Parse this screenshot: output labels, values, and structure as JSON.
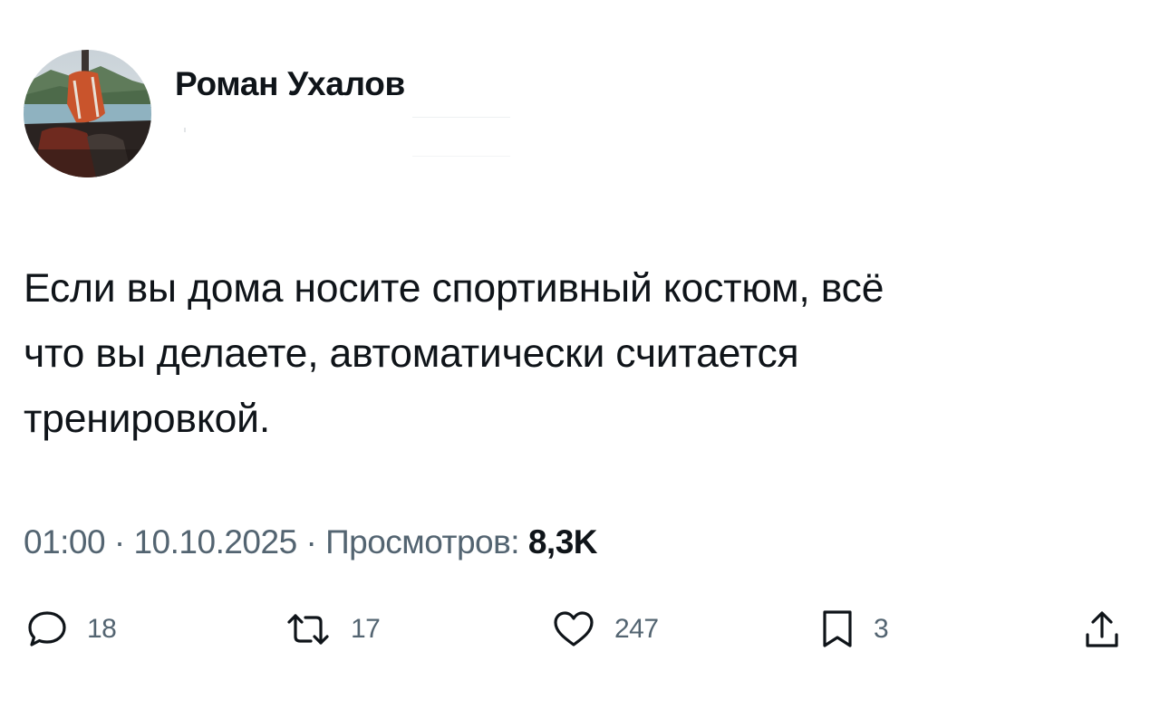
{
  "author": {
    "name": "Роман Ухалов"
  },
  "tweet": {
    "lines": [
      "Если вы дома носите спортивный костюм, всё",
      "что вы делаете, автоматически считается",
      "тренировкой."
    ]
  },
  "meta": {
    "time": "01:00",
    "separator": "·",
    "date": "10.10.2025",
    "views_label": "Просмотров:",
    "views_count": "8,3K"
  },
  "actions": {
    "reply": {
      "icon": "reply-icon",
      "count": "18"
    },
    "retweet": {
      "icon": "retweet-icon",
      "count": "17"
    },
    "like": {
      "icon": "heart-icon",
      "count": "247"
    },
    "bookmark": {
      "icon": "bookmark-icon",
      "count": "3"
    },
    "share": {
      "icon": "share-icon"
    }
  },
  "colors": {
    "text": "#0f1419",
    "secondary": "#536471",
    "background": "#ffffff"
  }
}
